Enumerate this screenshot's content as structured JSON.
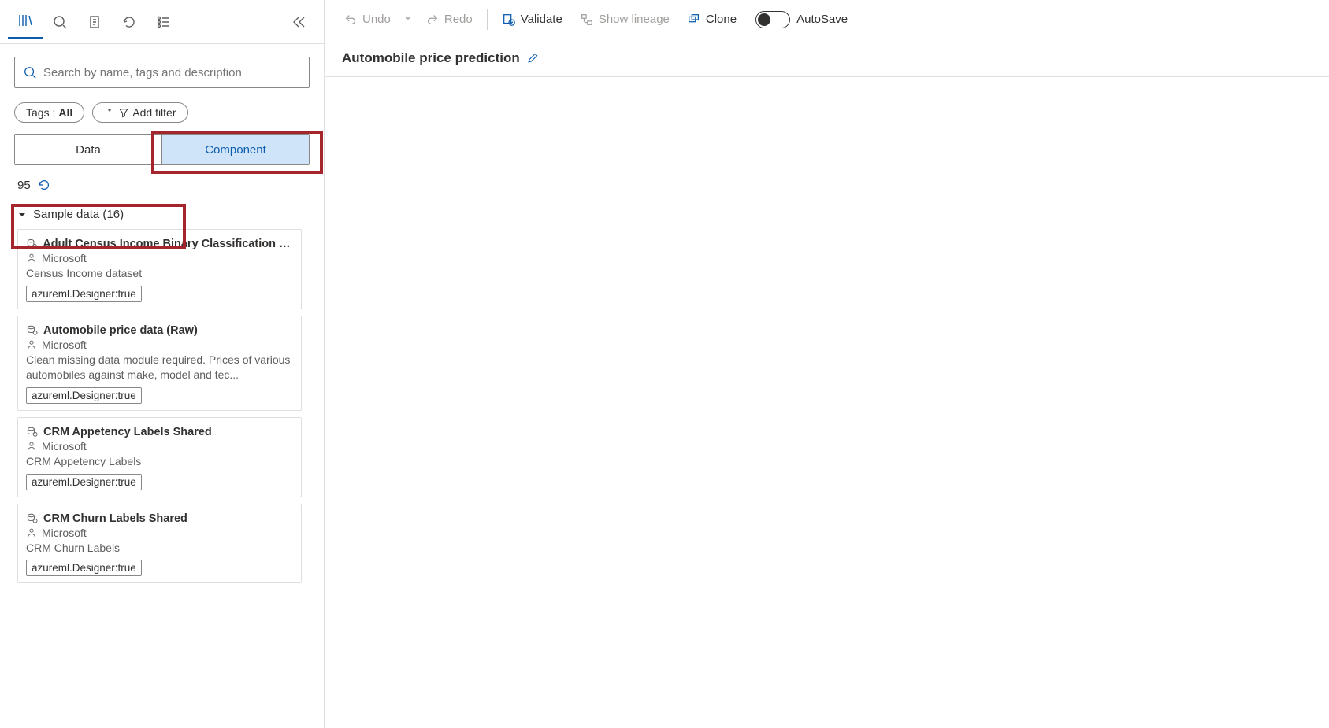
{
  "leftToolbar": {
    "icons": {
      "library": "library-icon",
      "search": "search-icon",
      "clipboard": "clipboard-icon",
      "refresh": "refresh-icon",
      "list": "list-icon",
      "collapse": "collapse-icon"
    }
  },
  "search": {
    "placeholder": "Search by name, tags and description"
  },
  "filters": {
    "tagsLabel": "Tags :",
    "tagsValue": "All",
    "addFilter": "Add filter"
  },
  "tabs": {
    "data": "Data",
    "component": "Component"
  },
  "count": "95",
  "section": {
    "title": "Sample data (16)"
  },
  "cards": [
    {
      "title": "Adult Census Income Binary Classification dat...",
      "author": "Microsoft",
      "desc": "Census Income dataset",
      "tag": "azureml.Designer:true"
    },
    {
      "title": "Automobile price data (Raw)",
      "author": "Microsoft",
      "desc": "Clean missing data module required. Prices of various automobiles against make, model and tec...",
      "tag": "azureml.Designer:true"
    },
    {
      "title": "CRM Appetency Labels Shared",
      "author": "Microsoft",
      "desc": "CRM Appetency Labels",
      "tag": "azureml.Designer:true"
    },
    {
      "title": "CRM Churn Labels Shared",
      "author": "Microsoft",
      "desc": "CRM Churn Labels",
      "tag": "azureml.Designer:true"
    }
  ],
  "topbar": {
    "undo": "Undo",
    "redo": "Redo",
    "validate": "Validate",
    "lineage": "Show lineage",
    "clone": "Clone",
    "autosave": "AutoSave"
  },
  "pipeline": {
    "title": "Automobile price prediction"
  },
  "colors": {
    "accent": "#0b5cad",
    "highlight": "#a4262c"
  }
}
